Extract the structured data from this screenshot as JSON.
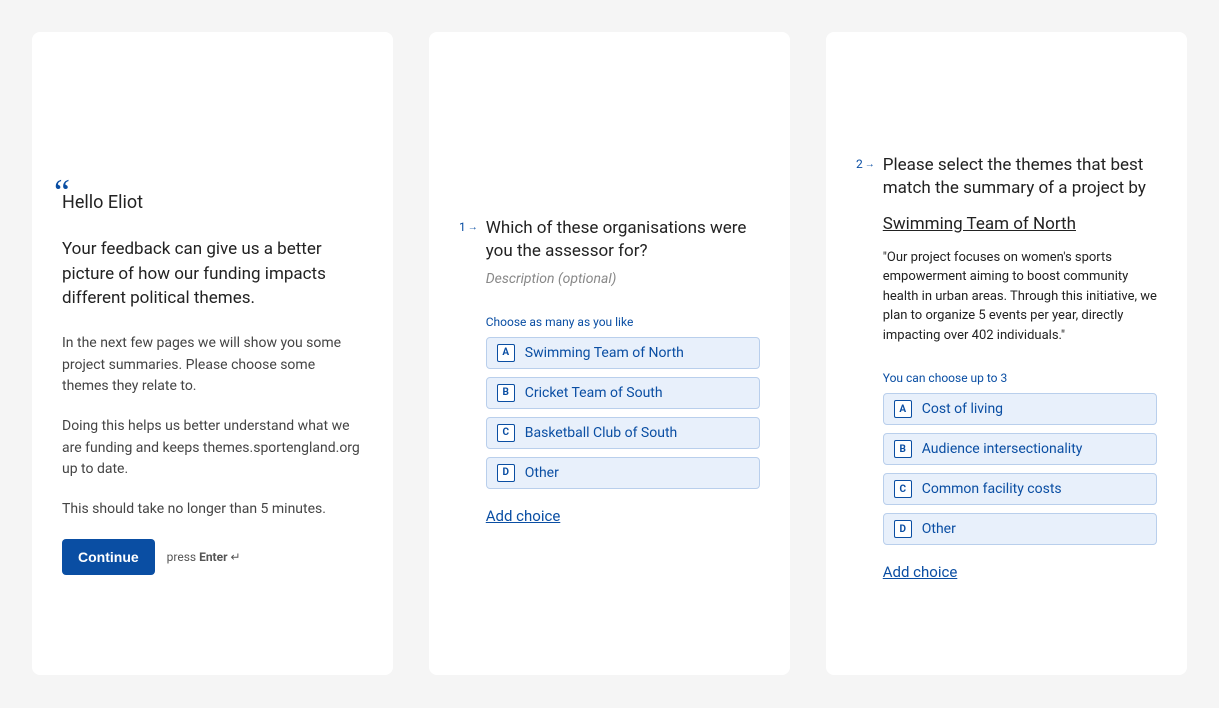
{
  "welcome": {
    "greeting": "Hello Eliot",
    "lead": "Your feedback can give us a better picture of how our funding impacts different political themes.",
    "para1": "In the next few pages we will show you some project summaries. Please choose some themes they relate to.",
    "para2": "Doing this helps us better understand what we are funding and keeps themes.sportengland.org up to date.",
    "para3": "This should take no longer than 5 minutes.",
    "continue_label": "Continue",
    "hint_press": "press ",
    "hint_enter": "Enter",
    "hint_symbol": " ↵"
  },
  "q1": {
    "number": "1",
    "title": "Which of these organisations were you the assessor for?",
    "description": "Description (optional)",
    "choose_hint": "Choose as many as you like",
    "choices": [
      {
        "key": "A",
        "label": "Swimming Team of North"
      },
      {
        "key": "B",
        "label": "Cricket Team of South"
      },
      {
        "key": "C",
        "label": "Basketball Club of South"
      },
      {
        "key": "D",
        "label": "Other"
      }
    ],
    "add_choice": "Add choice"
  },
  "q2": {
    "number": "2",
    "title": "Please select the themes that best match the summary of a project by",
    "project_name": "Swimming Team of North",
    "project_summary": "\"Our project focuses on women's sports empowerment aiming to boost community health in urban areas. Through this initiative, we plan to organize 5 events per year, directly impacting over 402 individuals.\"",
    "choose_hint": "You can choose up to 3",
    "choices": [
      {
        "key": "A",
        "label": "Cost of living"
      },
      {
        "key": "B",
        "label": "Audience intersectionality"
      },
      {
        "key": "C",
        "label": "Common facility costs"
      },
      {
        "key": "D",
        "label": "Other"
      }
    ],
    "add_choice": "Add choice"
  }
}
